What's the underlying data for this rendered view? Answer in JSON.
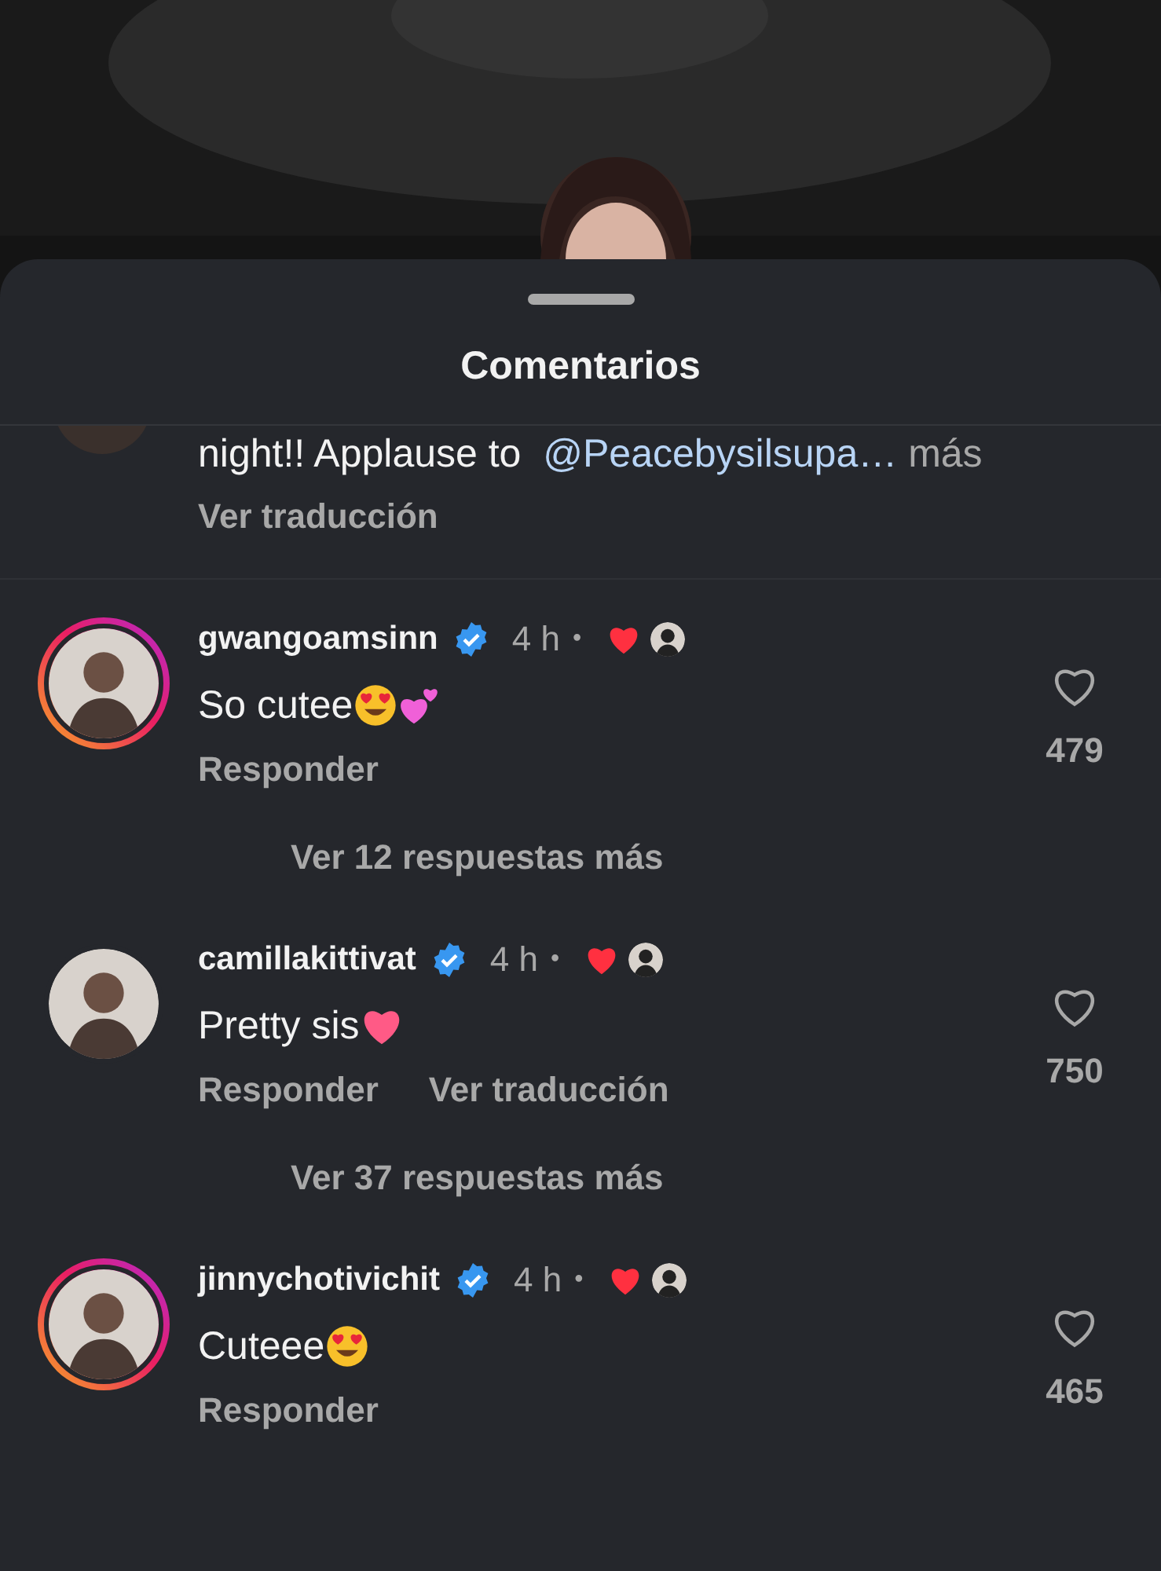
{
  "sheet": {
    "title": "Comentarios"
  },
  "partial_comment": {
    "text": "night!! Applause to",
    "mention": "@Peacebysilsupa…",
    "more": "más",
    "translate": "Ver traducción"
  },
  "comments": [
    {
      "username": "gwangoamsinn",
      "verified": true,
      "time": "4 h",
      "dot": "•",
      "liked_by_creator": true,
      "story_ring": true,
      "text": "So cutee",
      "emojis": [
        {
          "kind": "heart_eyes"
        },
        {
          "kind": "two_hearts"
        }
      ],
      "likes": "479",
      "actions": [
        "Responder"
      ],
      "replies": "Ver 12 respuestas más"
    },
    {
      "username": "camillakittivat",
      "verified": true,
      "time": "4 h",
      "dot": "•",
      "liked_by_creator": true,
      "story_ring": false,
      "text": "Pretty sis",
      "emojis": [
        {
          "kind": "pink_heart"
        }
      ],
      "likes": "750",
      "actions": [
        "Responder",
        "Ver traducción"
      ],
      "replies": "Ver 37 respuestas más"
    },
    {
      "username": "jinnychotivichit",
      "verified": true,
      "time": "4 h",
      "dot": "•",
      "liked_by_creator": true,
      "story_ring": true,
      "text": "Cuteee",
      "emojis": [
        {
          "kind": "heart_eyes"
        }
      ],
      "likes": "465",
      "actions": [
        "Responder"
      ]
    }
  ]
}
